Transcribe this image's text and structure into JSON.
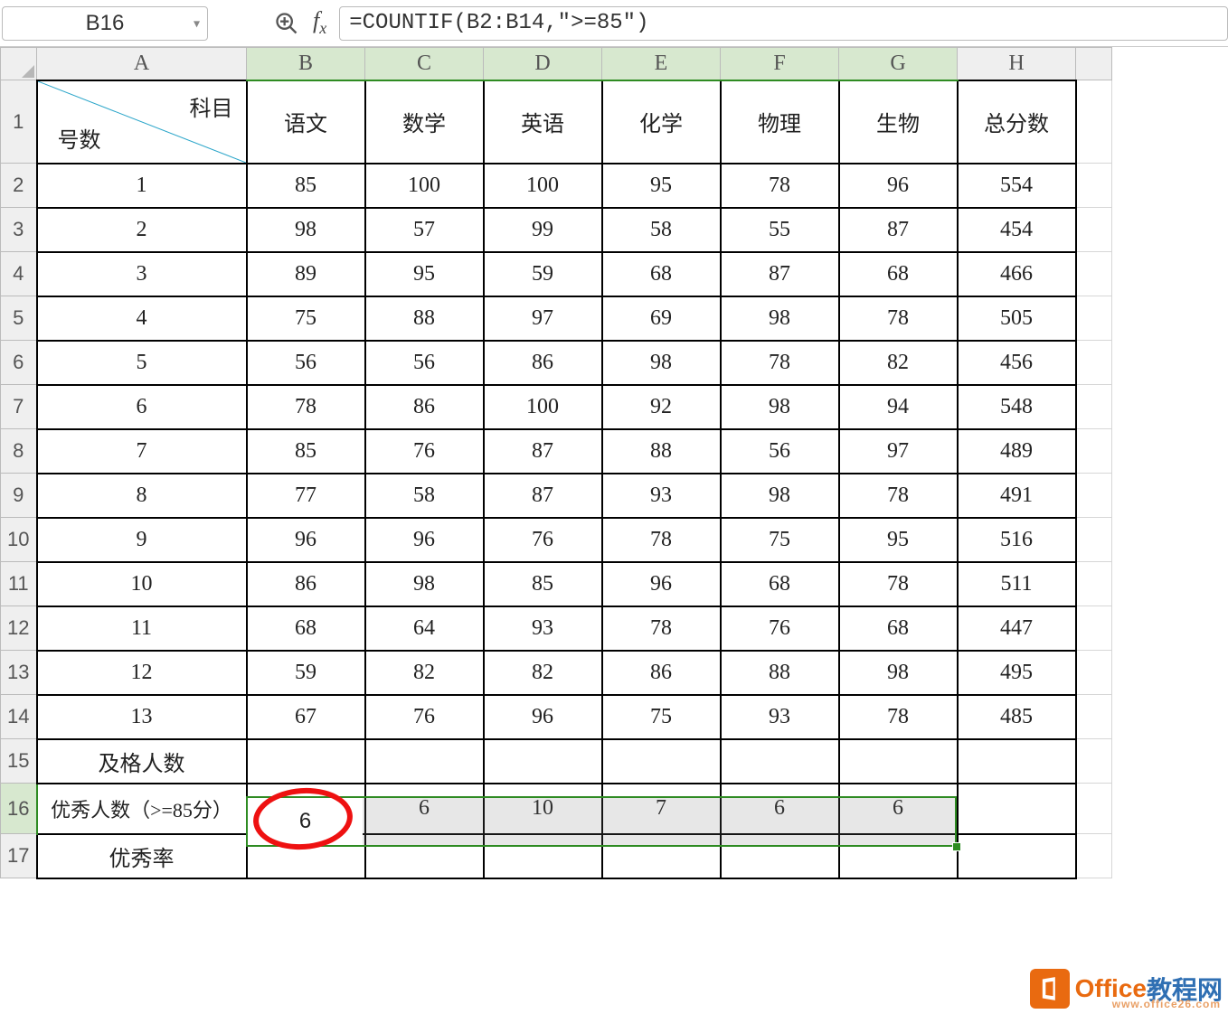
{
  "namebox": {
    "value": "B16"
  },
  "formula": {
    "value": "=COUNTIF(B2:B14,\">=85\")"
  },
  "columns": [
    "A",
    "B",
    "C",
    "D",
    "E",
    "F",
    "G",
    "H"
  ],
  "diag_header": {
    "top_right": "科目",
    "bottom_left": "号数"
  },
  "subjects": [
    "语文",
    "数学",
    "英语",
    "化学",
    "物理",
    "生物",
    "总分数"
  ],
  "rows": [
    {
      "n": "1",
      "v": [
        85,
        100,
        100,
        95,
        78,
        96,
        554
      ]
    },
    {
      "n": "2",
      "v": [
        98,
        57,
        99,
        58,
        55,
        87,
        454
      ]
    },
    {
      "n": "3",
      "v": [
        89,
        95,
        59,
        68,
        87,
        68,
        466
      ]
    },
    {
      "n": "4",
      "v": [
        75,
        88,
        97,
        69,
        98,
        78,
        505
      ]
    },
    {
      "n": "5",
      "v": [
        56,
        56,
        86,
        98,
        78,
        82,
        456
      ]
    },
    {
      "n": "6",
      "v": [
        78,
        86,
        100,
        92,
        98,
        94,
        548
      ]
    },
    {
      "n": "7",
      "v": [
        85,
        76,
        87,
        88,
        56,
        97,
        489
      ]
    },
    {
      "n": "8",
      "v": [
        77,
        58,
        87,
        93,
        98,
        78,
        491
      ]
    },
    {
      "n": "9",
      "v": [
        96,
        96,
        76,
        78,
        75,
        95,
        516
      ]
    },
    {
      "n": "10",
      "v": [
        86,
        98,
        85,
        96,
        68,
        78,
        511
      ]
    },
    {
      "n": "11",
      "v": [
        68,
        64,
        93,
        78,
        76,
        68,
        447
      ]
    },
    {
      "n": "12",
      "v": [
        59,
        82,
        82,
        86,
        88,
        98,
        495
      ]
    },
    {
      "n": "13",
      "v": [
        67,
        76,
        96,
        75,
        93,
        78,
        485
      ]
    }
  ],
  "summary_rows": {
    "pass_label": "及格人数",
    "excellent_label": "优秀人数（>=85分）",
    "excellent_values": [
      6,
      6,
      10,
      7,
      6,
      6
    ],
    "rate_label": "优秀率"
  },
  "watermark": {
    "brand1": "Office",
    "brand2": "教程网",
    "url": "www.office26.com"
  },
  "chart_data": {
    "type": "table",
    "title": "成绩表",
    "columns": [
      "号数",
      "语文",
      "数学",
      "英语",
      "化学",
      "物理",
      "生物",
      "总分数"
    ],
    "rows": [
      [
        1,
        85,
        100,
        100,
        95,
        78,
        96,
        554
      ],
      [
        2,
        98,
        57,
        99,
        58,
        55,
        87,
        454
      ],
      [
        3,
        89,
        95,
        59,
        68,
        87,
        68,
        466
      ],
      [
        4,
        75,
        88,
        97,
        69,
        98,
        78,
        505
      ],
      [
        5,
        56,
        56,
        86,
        98,
        78,
        82,
        456
      ],
      [
        6,
        78,
        86,
        100,
        92,
        98,
        94,
        548
      ],
      [
        7,
        85,
        76,
        87,
        88,
        56,
        97,
        489
      ],
      [
        8,
        77,
        58,
        87,
        93,
        98,
        78,
        491
      ],
      [
        9,
        96,
        96,
        76,
        78,
        75,
        95,
        516
      ],
      [
        10,
        86,
        98,
        85,
        96,
        68,
        78,
        511
      ],
      [
        11,
        68,
        64,
        93,
        78,
        76,
        68,
        447
      ],
      [
        12,
        59,
        82,
        82,
        86,
        88,
        98,
        495
      ],
      [
        13,
        67,
        76,
        96,
        75,
        93,
        78,
        485
      ]
    ],
    "summary": {
      "优秀人数（>=85分）": [
        6,
        6,
        10,
        7,
        6,
        6
      ]
    }
  }
}
